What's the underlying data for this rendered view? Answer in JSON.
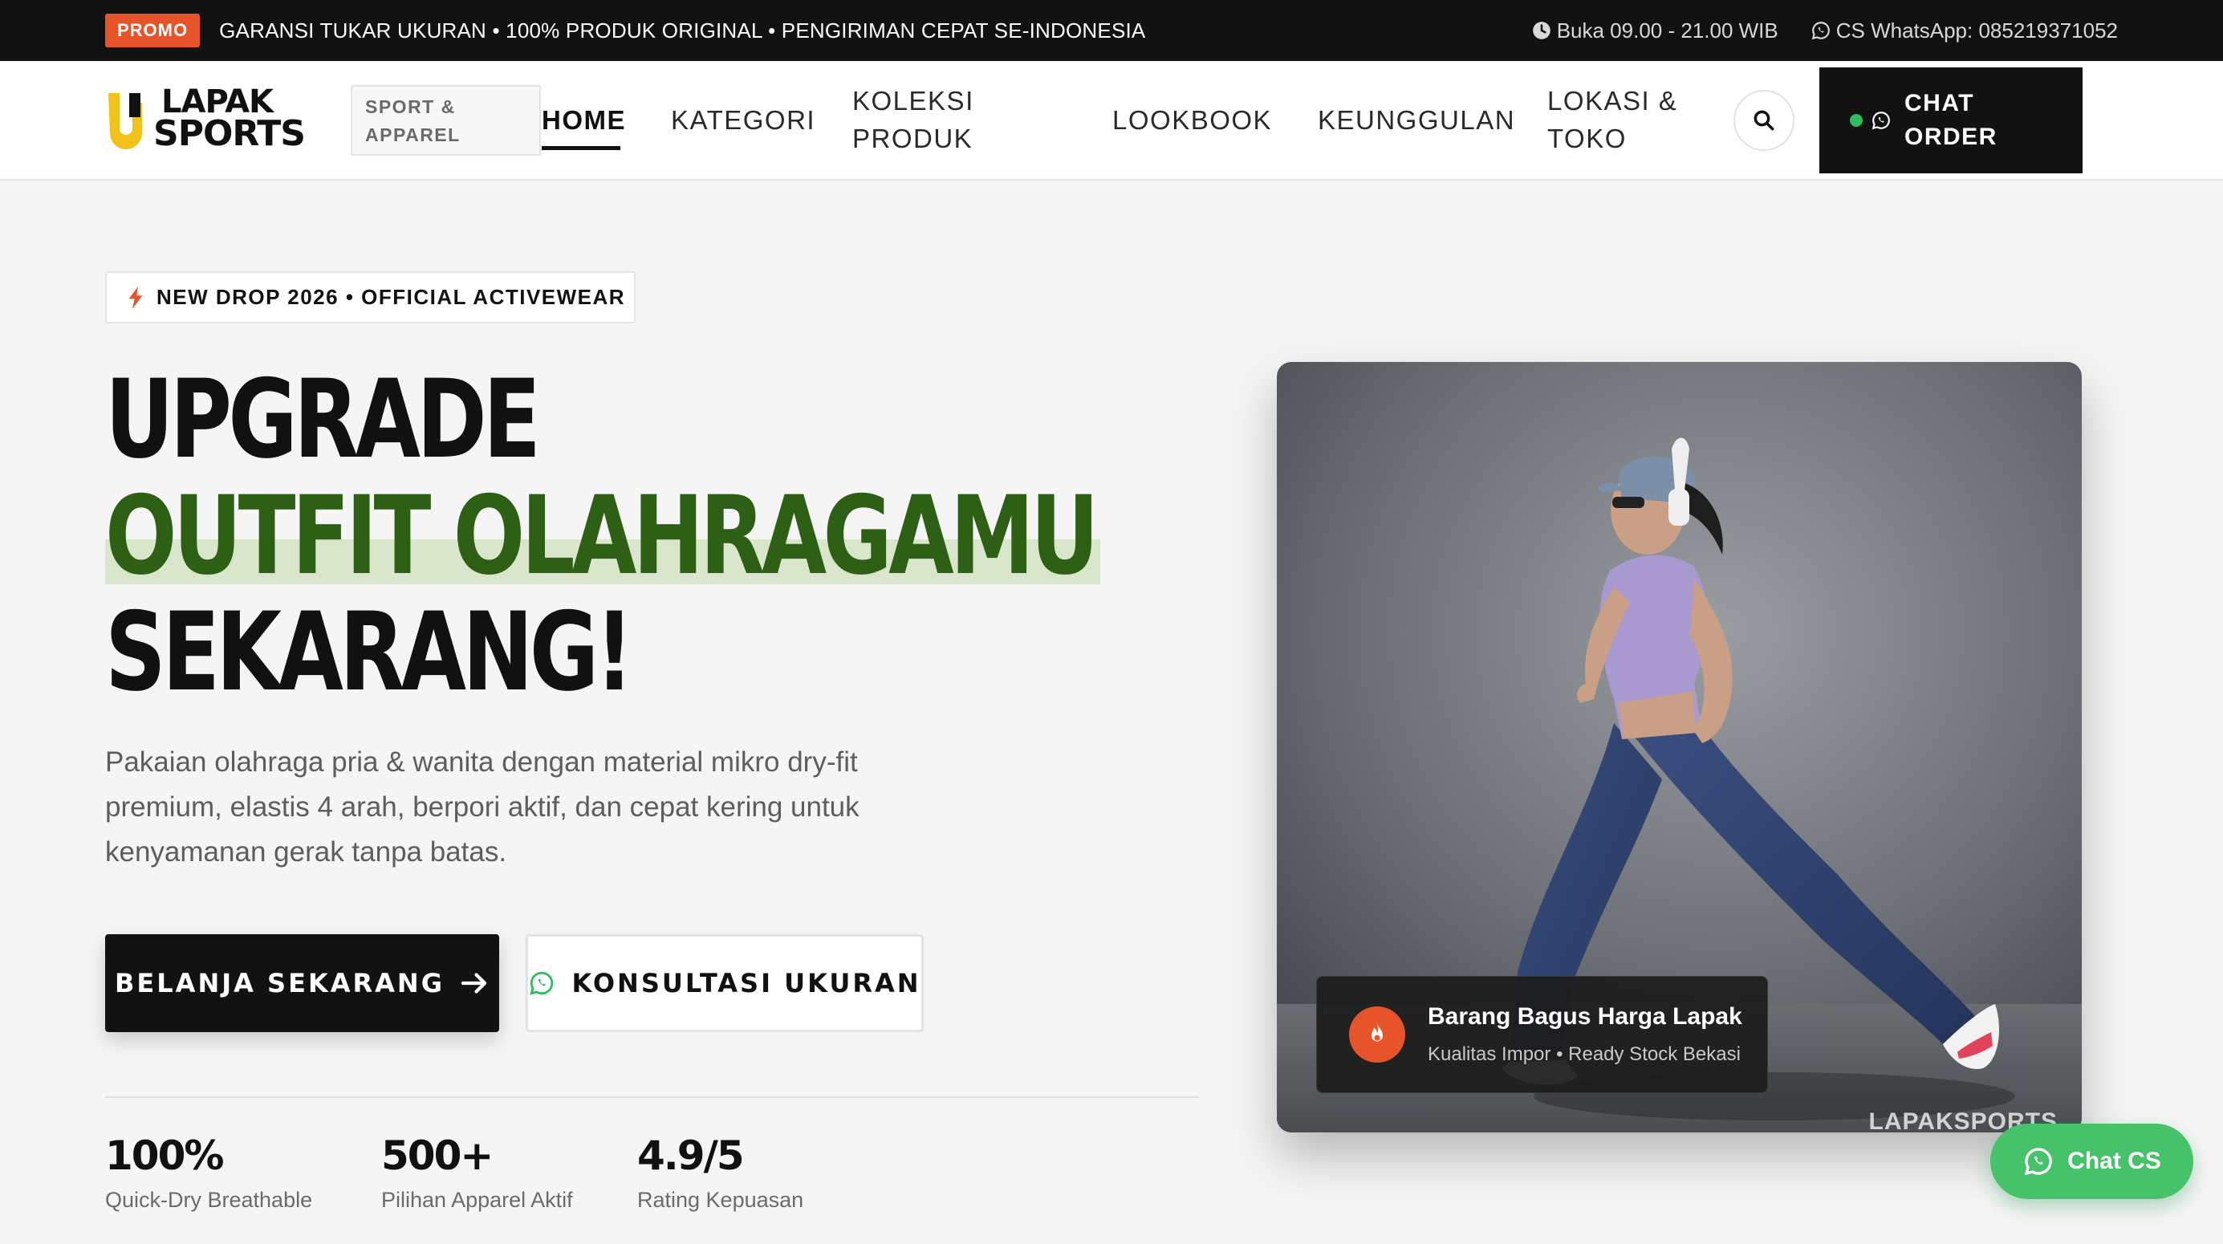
{
  "topbar": {
    "promo_badge": "PROMO",
    "ticker": "GARANSI TUKAR UKURAN • 100% PRODUK ORIGINAL • PENGIRIMAN CEPAT SE-INDONESIA",
    "hours": "Buka 09.00 - 21.00 WIB",
    "whatsapp": "CS WhatsApp: 085219371052"
  },
  "header": {
    "logo_line1": "LAPAK",
    "logo_line2": "SPORTS",
    "tagline_line1": "SPORT &",
    "tagline_line2": "APPAREL",
    "nav": {
      "home": "HOME",
      "kategori": "KATEGORI",
      "koleksi_1": "KOLEKSI",
      "koleksi_2": "PRODUK",
      "lookbook": "LOOKBOOK",
      "keunggulan": "KEUNGGULAN",
      "lokasi_1": "LOKASI &",
      "lokasi_2": "TOKO"
    },
    "chat_order_1": "CHAT",
    "chat_order_2": "ORDER"
  },
  "hero": {
    "badge": "NEW DROP 2026 • OFFICIAL ACTIVEWEAR",
    "headline_1": "UPGRADE",
    "headline_2": "OUTFIT OLAHRAGAMU",
    "headline_3": "SEKARANG!",
    "subtitle": "Pakaian olahraga pria & wanita dengan material mikro dry-fit premium, elastis 4 arah, berpori aktif, dan cepat kering untuk kenyamanan gerak tanpa batas.",
    "cta_primary": "BELANJA SEKARANG",
    "cta_secondary": "KONSULTASI UKURAN",
    "stats": [
      {
        "value": "100%",
        "label": "Quick-Dry Breathable"
      },
      {
        "value": "500+",
        "label": "Pilihan Apparel Aktif"
      },
      {
        "value": "4.9/5",
        "label": "Rating Kepuasan"
      }
    ],
    "card_title": "Barang Bagus Harga Lapak",
    "card_subtitle": "Kualitas Impor • Ready Stock Bekasi",
    "watermark": "LAPAKSPORTS"
  },
  "float_chat": "Chat CS",
  "colors": {
    "accent_orange": "#e8542a",
    "headline_green": "#2d5f14",
    "whatsapp_green": "#46c26a",
    "dark": "#121212"
  },
  "icons": [
    "clock-icon",
    "whatsapp-icon",
    "search-icon",
    "bolt-icon",
    "arrow-right-icon",
    "flame-icon"
  ]
}
